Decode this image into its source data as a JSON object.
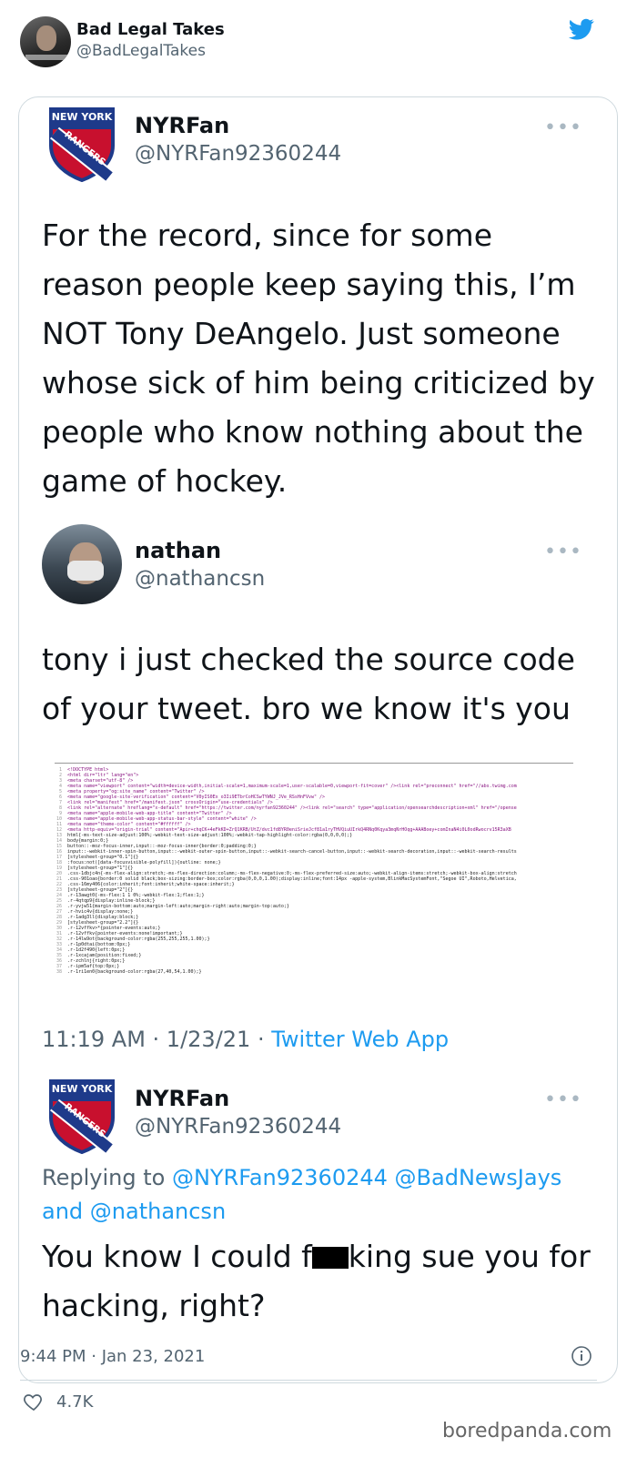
{
  "outer_tweet": {
    "author_name": "Bad Legal Takes",
    "author_handle": "@BadLegalTakes",
    "date": "9:44 PM · Jan 23, 2021",
    "likes": "4.7K",
    "watermark": "boredpanda.com"
  },
  "quoted_tweet": {
    "author_name": "NYRFan",
    "author_handle": "@NYRFan92360244",
    "more": "•••",
    "text_lines": [
      "For the record, since for some",
      "reason people keep saying this, I’m",
      "NOT Tony DeAngelo. Just someone",
      "whose sick of him being criticized by",
      "people who know nothing about the",
      "game of hockey."
    ],
    "logo_text": [
      "NEW YORK",
      "RANGERS"
    ]
  },
  "nathan_tweet": {
    "author_name": "nathan",
    "author_handle": "@nathancsn",
    "more": "•••",
    "text_lines": [
      "tony i just checked the source code",
      "of your tweet. bro we know it's you"
    ],
    "meta_time": "11:19 AM · 1/23/21 · ",
    "meta_app": "Twitter Web App",
    "code_lines": [
      "<!DOCTYPE html>",
      "<html dir=\"ltr\" lang=\"en\">",
      "<meta charset=\"utf-8\" />",
      "<meta name=\"viewport\" content=\"width=device-width,initial-scale=1,maximum-scale=1,user-scalable=0,viewport-fit=cover\" /><link rel=\"preconnect\" href=\"//abs.twimg.com",
      "<meta property=\"og:site_name\" content=\"Twitter\" />",
      "<meta name=\"google-site-verification\" content=\"V0yIS0Ex_o3Ii9ETbrCoHCSwTYWNJ_JVe_RSsHnFVvw\" />",
      "<link rel=\"manifest\" href=\"/manifest.json\" crossOrigin=\"use-credentials\" />",
      "<link rel=\"alternate\" hreflang=\"x-default\" href=\"https://twitter.com/nyrfan92360244\" /><link rel=\"search\" type=\"application/opensearchdescription+xml\" href=\"/opense",
      "<meta name=\"apple-mobile-web-app-title\" content=\"Twitter\" />",
      "<meta name=\"apple-mobile-web-app-status-bar-style\" content=\"white\" />",
      "<meta name=\"theme-color\" content=\"#ffffff\" />",
      "<meta http-equiv=\"origin-trial\" content=\"Apir+chqCK+4eFkKD+ZrQ1KRB/UtZ/dvc1fd8YR0eniSrieJcf81a1ryTHVQiuUIrkQ4RNq0Kqya3mqNrHOqg+AAABoey+comInaN4i0L0odRwocrv15R3aXB",
      "html{-ms-text-size-adjust:100%;-webkit-text-size-adjust:100%;-webkit-tap-highlight-color:rgba(0,0,0,0);}",
      "body{margin:0;}",
      "button::-moz-focus-inner,input::-moz-focus-inner{border:0;padding:0;}",
      "input::-webkit-inner-spin-button,input::-webkit-outer-spin-button,input::-webkit-search-cancel-button,input::-webkit-search-decoration,input::-webkit-search-results",
      "[stylesheet-group=\"0.1\"]{}",
      ":focus:not([data-focusvisible-polyfill]){outline: none;}",
      "[stylesheet-group=\"1\"]{}",
      ".css-1dbjc4n{-ms-flex-align:stretch;-ms-flex-direction:column;-ms-flex-negative:0;-ms-flex-preferred-size:auto;-webkit-align-items:stretch;-webkit-box-align:stretch",
      ".css-901oao{border:0 solid black;box-sizing:border-box;color:rgba(0,0,0,1.00);display:inline;font:14px -apple-system,BlinkMacSystemFont,\"Segoe UI\",Roboto,Helvetica,",
      ".css-16my406{color:inherit;font:inherit;white-space:inherit;}",
      "[stylesheet-group=\"2\"]{}",
      ".r-13awgt0{-ms-flex:1 1 0%;-webkit-flex:1;flex:1;}",
      ".r-4qtqp9{display:inline-block;}",
      ".r-yvjw51{margin-bottom:auto;margin-left:auto;margin-right:auto;margin-top:auto;}",
      ".r-hvic4v{display:none;}",
      ".r-1adg3ll{display:block;}",
      "[stylesheet-group=\"2.2\"]{}",
      ".r-12vffkv>*{pointer-events:auto;}",
      ".r-12vffkv{pointer-events:none!important;}",
      ".r-14lw9ot{background-color:rgba(255,255,255,1.00);}",
      ".r-1p0dtai{bottom:0px;}",
      ".r-1d2f490{left:0px;}",
      ".r-1xcajam{position:fixed;}",
      ".r-zchlnj{right:0px;}",
      ".r-ipm5af{top:0px;}",
      ".r-1ri1en0{background-color:rgba(27,40,54,1.00);}"
    ]
  },
  "reply_tweet": {
    "author_name": "NYRFan",
    "author_handle": "@NYRFan92360244",
    "more": "•••",
    "replying_prefix": "Replying to ",
    "replying_handles": "@NYRFan92360244 @BadNewsJays",
    "replying_and": "and ",
    "replying_last": "@nathancsn",
    "text_before": "You know I could f",
    "text_after": "king sue you for",
    "text_line2": "hacking, right?"
  },
  "colors": {
    "accent": "#1d9bf0",
    "muted": "#536471",
    "border": "#cfd9de",
    "rangers_blue": "#1e3a8a",
    "rangers_red": "#c8102e"
  }
}
